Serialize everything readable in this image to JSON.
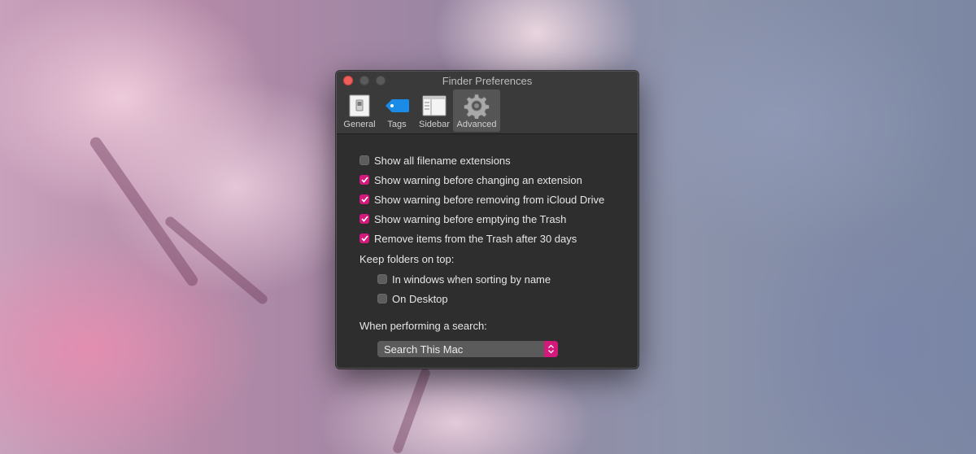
{
  "window": {
    "title": "Finder Preferences"
  },
  "toolbar": {
    "tabs": [
      {
        "label": "General",
        "icon": "general-switch-icon"
      },
      {
        "label": "Tags",
        "icon": "tag-icon"
      },
      {
        "label": "Sidebar",
        "icon": "sidebar-icon"
      },
      {
        "label": "Advanced",
        "icon": "gear-icon",
        "active": true
      }
    ]
  },
  "options": [
    {
      "label": "Show all filename extensions",
      "checked": false
    },
    {
      "label": "Show warning before changing an extension",
      "checked": true
    },
    {
      "label": "Show warning before removing from iCloud Drive",
      "checked": true
    },
    {
      "label": "Show warning before emptying the Trash",
      "checked": true
    },
    {
      "label": "Remove items from the Trash after 30 days",
      "checked": true
    }
  ],
  "folders_section": {
    "heading": "Keep folders on top:",
    "options": [
      {
        "label": "In windows when sorting by name",
        "checked": false
      },
      {
        "label": "On Desktop",
        "checked": false
      }
    ]
  },
  "search_section": {
    "heading": "When performing a search:",
    "selected": "Search This Mac"
  },
  "colors": {
    "accent": "#d4197c",
    "window_bg": "#2e2e2e",
    "titlebar_bg": "#3a3a3a",
    "close_button": "#ec5f5a"
  }
}
